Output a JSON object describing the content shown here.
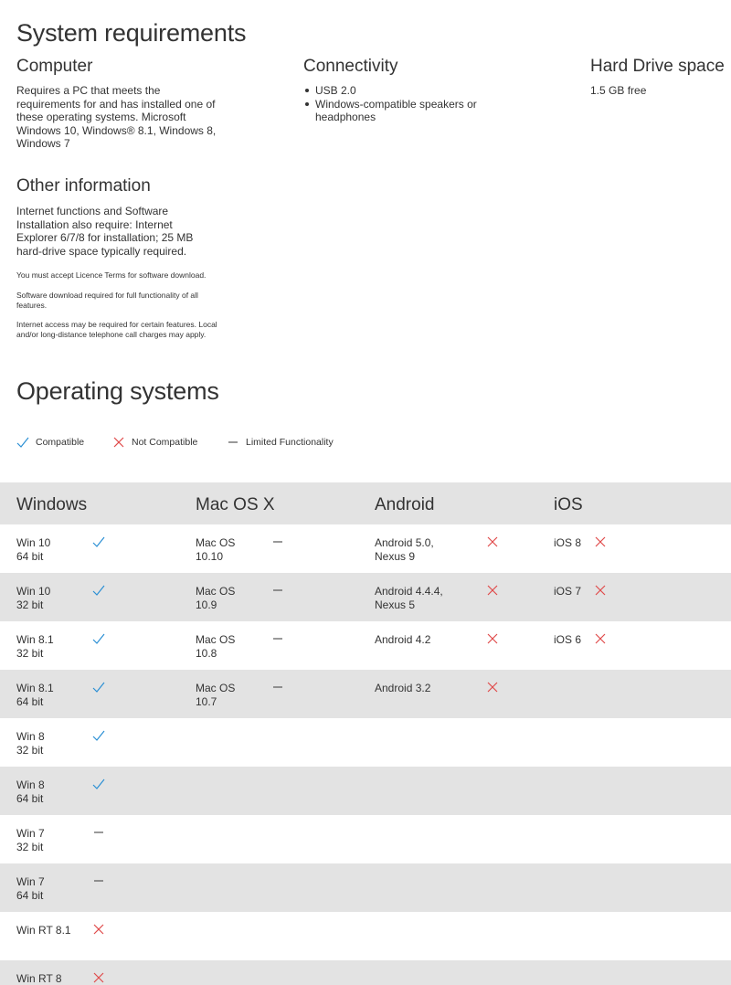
{
  "page": {
    "title": "System requirements"
  },
  "computer": {
    "heading": "Computer",
    "text": "Requires a PC that meets the requirements for and has installed one of these operating systems. Microsoft Windows 10, Windows® 8.1, Windows 8, Windows 7"
  },
  "connectivity": {
    "heading": "Connectivity",
    "items": [
      "USB 2.0",
      "Windows-compatible speakers or headphones"
    ]
  },
  "hard_drive": {
    "heading": "Hard Drive space",
    "text": "1.5 GB free"
  },
  "other_info": {
    "heading": "Other information",
    "text": "Internet functions and Software Installation also require: Internet Explorer 6/7/8 for installation; 25 MB hard-drive space typically required.",
    "notes": [
      "You must accept Licence Terms for software download.",
      "Software download required for full functionality of all features.",
      "Internet access may be required for certain features. Local and/or long-distance telephone call charges may apply."
    ]
  },
  "os_section": {
    "heading": "Operating systems"
  },
  "legend": {
    "compatible": "Compatible",
    "not_compatible": "Not Compatible",
    "limited": "Limited Functionality"
  },
  "colors": {
    "compatible": "#2a8fd4",
    "not_compatible": "#e04a4a",
    "limited": "#555555",
    "row_shade": "#e3e3e3"
  },
  "table": {
    "columns": [
      "Windows",
      "Mac OS X",
      "Android",
      "iOS"
    ],
    "windows": [
      {
        "line1": "Win 10",
        "line2": "64 bit",
        "status": "compatible"
      },
      {
        "line1": "Win 10",
        "line2": "32 bit",
        "status": "compatible"
      },
      {
        "line1": "Win 8.1",
        "line2": "32 bit",
        "status": "compatible"
      },
      {
        "line1": "Win 8.1",
        "line2": "64 bit",
        "status": "compatible"
      },
      {
        "line1": "Win 8",
        "line2": "32 bit",
        "status": "compatible"
      },
      {
        "line1": "Win 8",
        "line2": "64 bit",
        "status": "compatible"
      },
      {
        "line1": "Win 7",
        "line2": "32 bit",
        "status": "limited"
      },
      {
        "line1": "Win 7",
        "line2": "64 bit",
        "status": "limited"
      },
      {
        "line1": "Win RT 8.1",
        "line2": "",
        "status": "not_compatible"
      },
      {
        "line1": "Win RT 8",
        "line2": "",
        "status": "not_compatible"
      }
    ],
    "mac": [
      {
        "line1": "Mac OS",
        "line2": "10.10",
        "status": "limited"
      },
      {
        "line1": "Mac OS",
        "line2": "10.9",
        "status": "limited"
      },
      {
        "line1": "Mac OS",
        "line2": "10.8",
        "status": "limited"
      },
      {
        "line1": "Mac OS",
        "line2": "10.7",
        "status": "limited"
      }
    ],
    "android": [
      {
        "line1": "Android 5.0,",
        "line2": "Nexus 9",
        "status": "not_compatible"
      },
      {
        "line1": "Android 4.4.4,",
        "line2": "Nexus 5",
        "status": "not_compatible"
      },
      {
        "line1": "Android 4.2",
        "line2": "",
        "status": "not_compatible"
      },
      {
        "line1": "Android 3.2",
        "line2": "",
        "status": "not_compatible"
      }
    ],
    "ios": [
      {
        "line1": "iOS 8",
        "line2": "",
        "status": "not_compatible"
      },
      {
        "line1": "iOS 7",
        "line2": "",
        "status": "not_compatible"
      },
      {
        "line1": "iOS 6",
        "line2": "",
        "status": "not_compatible"
      }
    ]
  }
}
